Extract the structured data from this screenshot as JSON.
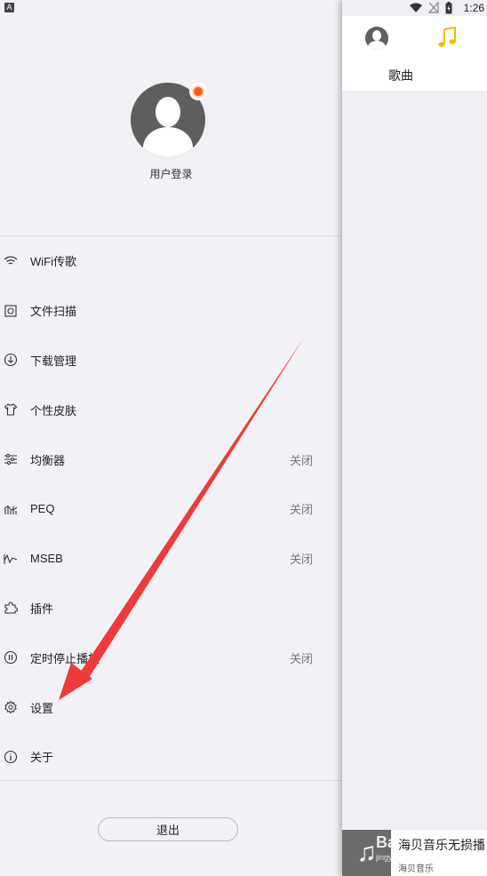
{
  "status": {
    "indicator": "A",
    "time": "1:26"
  },
  "drawer": {
    "login_label": "用户登录",
    "menu": [
      {
        "icon": "wifi-icon",
        "label": "WiFi传歌",
        "state": ""
      },
      {
        "icon": "file-scan-icon",
        "label": "文件扫描",
        "state": ""
      },
      {
        "icon": "download-icon",
        "label": "下载管理",
        "state": ""
      },
      {
        "icon": "shirt-icon",
        "label": "个性皮肤",
        "state": ""
      },
      {
        "icon": "equalizer-icon",
        "label": "均衡器",
        "state": "关闭"
      },
      {
        "icon": "peq-icon",
        "label": "PEQ",
        "state": "关闭"
      },
      {
        "icon": "mseb-icon",
        "label": "MSEB",
        "state": "关闭"
      },
      {
        "icon": "puzzle-icon",
        "label": "插件",
        "state": ""
      },
      {
        "icon": "timer-icon",
        "label": "定时停止播放",
        "state": "关闭"
      },
      {
        "icon": "gear-icon",
        "label": "设置",
        "state": ""
      },
      {
        "icon": "info-icon",
        "label": "关于",
        "state": ""
      }
    ],
    "logout_label": "退出"
  },
  "panel": {
    "song_tab": "歌曲",
    "player_title": "海贝音乐无损播",
    "player_subtitle": "海贝音乐",
    "watermark": "Bai",
    "watermark_sub": "jingyan"
  },
  "colors": {
    "accent": "#f5b700",
    "arrow": "#f03a3a",
    "notification": "#ff5a1f"
  }
}
